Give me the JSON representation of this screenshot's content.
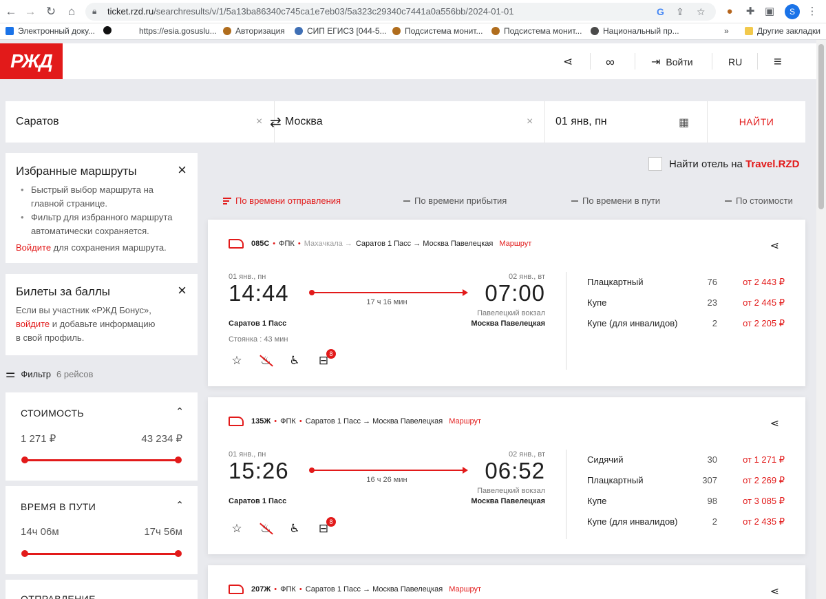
{
  "browser": {
    "url_host": "ticket.rzd.ru",
    "url_path": "/searchresults/v/1/5a13ba86340c745ca1e7eb03/5a323c29340c7441a0a556bb/2024-01-01",
    "profile_initial": "S",
    "bookmarks": [
      {
        "label": "Электронный доку...",
        "color": "#1a73e8"
      },
      {
        "label": "",
        "color": "#111111"
      },
      {
        "label": "https://esia.gosuslu...",
        "color": "#ffffff"
      },
      {
        "label": "Авторизация",
        "color": "#b06d1d"
      },
      {
        "label": "СИП ЕГИСЗ [044-5...",
        "color": "#3f6fb5"
      },
      {
        "label": "Подсистема монит...",
        "color": "#b06d1d"
      },
      {
        "label": "Подсистема монит...",
        "color": "#b06d1d"
      },
      {
        "label": "Национальный пр...",
        "color": "#4a4a4a"
      }
    ],
    "bookmarks_more": "»",
    "other_bookmarks": "Другие закладки"
  },
  "header": {
    "logo": "РЖД",
    "login": "Войти",
    "lang": "RU"
  },
  "search": {
    "from": "Саратов",
    "to": "Москва",
    "date": "01 янв, пн",
    "submit": "НАЙТИ"
  },
  "favorites": {
    "title": "Избранные маршруты",
    "items": [
      "Быстрый выбор маршрута на главной странице.",
      "Фильтр для избранного маршрута автоматически сохраняется."
    ],
    "login_link": "Войдите",
    "login_rest": " для сохранения маршрута."
  },
  "bonus": {
    "title": "Билеты за баллы",
    "text1": "Если вы участник «РЖД Бонус»,",
    "link": "войдите",
    "text2": " и добавьте информацию",
    "text3": "в свой профиль."
  },
  "filter": {
    "label": "Фильтр",
    "count": "6 рейсов",
    "boxes": [
      {
        "title": "СТОИМОСТЬ",
        "min": "1 271 ₽",
        "max": "43 234 ₽"
      },
      {
        "title": "ВРЕМЯ В ПУТИ",
        "min": "14ч 06м",
        "max": "17ч 56м"
      },
      {
        "title": "ОТПРАВЛЕНИЕ",
        "min": "",
        "max": ""
      }
    ]
  },
  "hotel": {
    "text": "Найти отель на ",
    "brand": "Travel.RZD"
  },
  "sort": {
    "departure": "По времени отправления",
    "arrival": "По времени прибытия",
    "travel": "По времени в пути",
    "price": "По стоимости"
  },
  "trains": [
    {
      "number": "085С",
      "carrier": "ФПК",
      "origin": "Махачкала →",
      "route": "Саратов 1 Пасс → Москва Павелецкая",
      "route_link": "Маршрут",
      "dep_date": "01 янв., пн",
      "arr_date": "02 янв., вт",
      "dep_time": "14:44",
      "arr_time": "07:00",
      "duration": "17 ч 16 мин",
      "dep_station": "Саратов 1 Пасс",
      "arr_station_sub": "Павелецкий вокзал",
      "arr_station": "Москва Павелецкая",
      "stop": "Стоянка : 43 мин",
      "badge": "8",
      "classes": [
        {
          "name": "Плацкартный",
          "seats": "76",
          "price": "от 2 443 ₽"
        },
        {
          "name": "Купе",
          "seats": "23",
          "price": "от 2 445 ₽"
        },
        {
          "name": "Купе (для инвалидов)",
          "seats": "2",
          "price": "от 2 205 ₽"
        }
      ]
    },
    {
      "number": "135Ж",
      "carrier": "ФПК",
      "origin": "",
      "route": "Саратов 1 Пасс → Москва Павелецкая",
      "route_link": "Маршрут",
      "dep_date": "01 янв., пн",
      "arr_date": "02 янв., вт",
      "dep_time": "15:26",
      "arr_time": "06:52",
      "duration": "16 ч 26 мин",
      "dep_station": "Саратов 1 Пасс",
      "arr_station_sub": "Павелецкий вокзал",
      "arr_station": "Москва Павелецкая",
      "stop": "",
      "badge": "8",
      "classes": [
        {
          "name": "Сидячий",
          "seats": "30",
          "price": "от 1 271 ₽"
        },
        {
          "name": "Плацкартный",
          "seats": "307",
          "price": "от 2 269 ₽"
        },
        {
          "name": "Купе",
          "seats": "98",
          "price": "от 3 085 ₽"
        },
        {
          "name": "Купе (для инвалидов)",
          "seats": "2",
          "price": "от 2 435 ₽"
        }
      ]
    },
    {
      "number": "207Ж",
      "carrier": "ФПК",
      "origin": "",
      "route": "Саратов 1 Пасс → Москва Павелецкая",
      "route_link": "Маршрут"
    }
  ]
}
